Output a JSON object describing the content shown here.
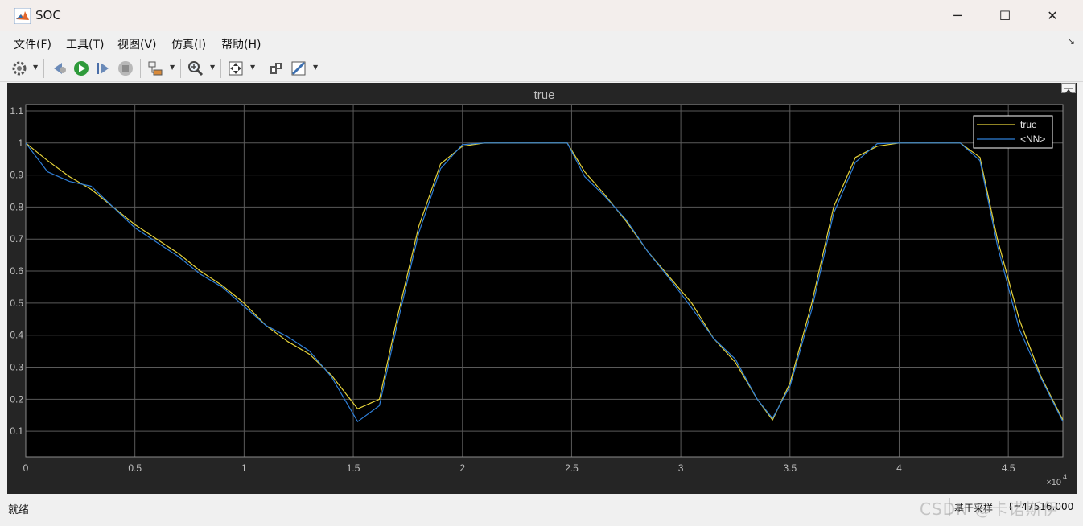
{
  "window": {
    "title": "SOC",
    "minimize_glyph": "─",
    "maximize_glyph": "☐",
    "close_glyph": "✕"
  },
  "menu": {
    "items": [
      "文件(F)",
      "工具(T)",
      "视图(V)",
      "仿真(I)",
      "帮助(H)"
    ],
    "undock_glyph": "↘"
  },
  "toolbar": {
    "icons": [
      "gear-icon",
      "step-back-icon",
      "run-icon",
      "step-forward-icon",
      "stop-icon",
      "signal-select-icon",
      "zoom-icon",
      "fit-to-view-icon",
      "style-icon",
      "measure-icon"
    ]
  },
  "colors": {
    "plot_bg": "#000000",
    "panel_bg": "#252525",
    "grid": "#5a5a5a",
    "axis_text": "#bfbfbf",
    "series_true": "#e6d33a",
    "series_nn": "#2f7fd8"
  },
  "chart_data": {
    "type": "line",
    "title": "true",
    "xlim": [
      0,
      47500
    ],
    "ylim": [
      0.02,
      1.12
    ],
    "x_exponent_label": "×10",
    "x_exponent": "4",
    "x_ticks": [
      0,
      5000,
      10000,
      15000,
      20000,
      25000,
      30000,
      35000,
      40000,
      45000
    ],
    "x_tick_labels": [
      "0",
      "0.5",
      "1",
      "1.5",
      "2",
      "2.5",
      "3",
      "3.5",
      "4",
      "4.5"
    ],
    "y_ticks": [
      0.1,
      0.2,
      0.3,
      0.4,
      0.5,
      0.6,
      0.7,
      0.8,
      0.9,
      1.0,
      1.1
    ],
    "y_tick_labels": [
      "0.1",
      "0.2",
      "0.3",
      "0.4",
      "0.5",
      "0.6",
      "0.7",
      "0.8",
      "0.9",
      "1",
      "1.1"
    ],
    "grid": true,
    "legend_position": "top-right",
    "series": [
      {
        "name": "true",
        "color": "#e6d33a",
        "x": [
          0,
          1000,
          2000,
          3000,
          4000,
          5000,
          6000,
          7000,
          8000,
          9000,
          10000,
          11000,
          12000,
          13000,
          14000,
          15200,
          16200,
          17000,
          18000,
          19000,
          20000,
          21000,
          22000,
          23000,
          24000,
          24800,
          25600,
          26500,
          27500,
          28500,
          29500,
          30500,
          31500,
          32500,
          33500,
          34200,
          35000,
          36000,
          37000,
          38000,
          39000,
          40000,
          41000,
          42000,
          42800,
          43700,
          44500,
          45500,
          46500,
          47500
        ],
        "y": [
          1.0,
          0.945,
          0.895,
          0.855,
          0.8,
          0.745,
          0.7,
          0.655,
          0.6,
          0.555,
          0.5,
          0.43,
          0.38,
          0.34,
          0.275,
          0.17,
          0.2,
          0.45,
          0.74,
          0.935,
          0.99,
          1.0,
          1.0,
          1.0,
          1.0,
          1.0,
          0.91,
          0.84,
          0.755,
          0.66,
          0.58,
          0.5,
          0.39,
          0.315,
          0.2,
          0.135,
          0.25,
          0.5,
          0.8,
          0.955,
          0.99,
          1.0,
          1.0,
          1.0,
          1.0,
          0.955,
          0.7,
          0.45,
          0.27,
          0.135
        ]
      },
      {
        "name": "<NN>",
        "color": "#2f7fd8",
        "x": [
          0,
          1000,
          2000,
          3000,
          4000,
          5000,
          6000,
          7000,
          8000,
          9000,
          10000,
          11000,
          12000,
          13000,
          14000,
          15200,
          16200,
          17000,
          18000,
          19000,
          20000,
          21000,
          22000,
          23000,
          24000,
          24800,
          25600,
          26500,
          27500,
          28500,
          29500,
          30500,
          31500,
          32500,
          33500,
          34200,
          35000,
          36000,
          37000,
          38000,
          39000,
          40000,
          41000,
          42000,
          42800,
          43700,
          44500,
          45500,
          46500,
          47500
        ],
        "y": [
          1.0,
          0.91,
          0.88,
          0.865,
          0.8,
          0.735,
          0.69,
          0.645,
          0.59,
          0.55,
          0.49,
          0.43,
          0.395,
          0.35,
          0.27,
          0.13,
          0.18,
          0.43,
          0.72,
          0.92,
          0.995,
          1.0,
          1.0,
          1.0,
          1.0,
          1.0,
          0.895,
          0.835,
          0.76,
          0.66,
          0.575,
          0.485,
          0.39,
          0.325,
          0.2,
          0.14,
          0.24,
          0.48,
          0.78,
          0.94,
          0.998,
          1.0,
          1.0,
          1.0,
          1.0,
          0.945,
          0.68,
          0.42,
          0.265,
          0.13
        ]
      }
    ]
  },
  "status": {
    "left": "就绪",
    "mode": "基于采样",
    "time": "T=47516.000"
  },
  "watermark": "CSDN @卡诺斯伊"
}
